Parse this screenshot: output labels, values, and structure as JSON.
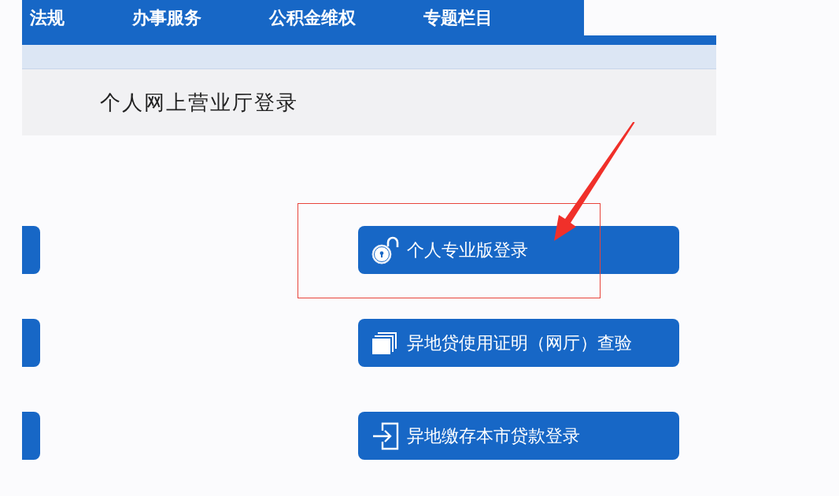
{
  "nav": {
    "items": [
      {
        "label": "法规"
      },
      {
        "label": "办事服务"
      },
      {
        "label": "公积金维权"
      },
      {
        "label": "专题栏目"
      }
    ]
  },
  "panel": {
    "title": "个人网上营业厅登录"
  },
  "login_options": [
    {
      "label": "个人专业版登录",
      "highlighted": true
    },
    {
      "label": "异地贷使用证明（网厅）查验",
      "highlighted": false
    },
    {
      "label": "异地缴存本市贷款登录",
      "highlighted": false
    }
  ]
}
